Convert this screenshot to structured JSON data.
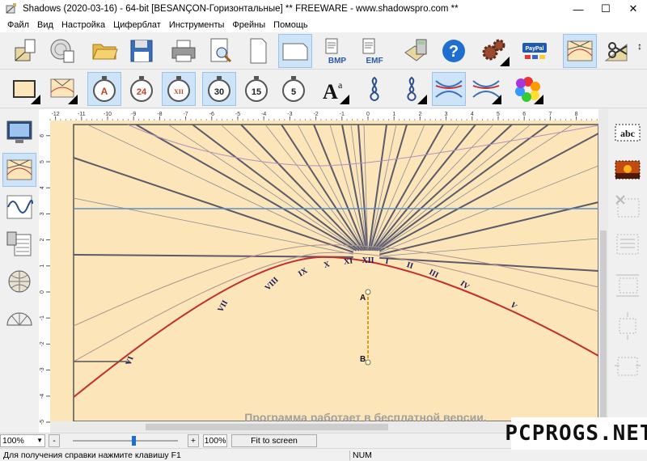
{
  "window": {
    "title": "Shadows (2020-03-16) - 64-bit [BESANÇON-Горизонтальные]   ** FREEWARE - www.shadowspro.com **",
    "minimize": "—",
    "maximize": "☐",
    "close": "✕"
  },
  "menu": [
    "Файл",
    "Вид",
    "Настройка",
    "Циферблат",
    "Инструменты",
    "Фрейны",
    "Помощь"
  ],
  "toolbar1": {
    "bmp_label": "BMP",
    "emf_label": "EMF",
    "help_label": "?",
    "paypal_label": "PayPal"
  },
  "toolbar2": {
    "clock_a": "A",
    "clock_24": "24",
    "clock_xii": "XII",
    "clock_30": "30",
    "clock_15": "15",
    "clock_5": "5",
    "font_label_big": "A",
    "font_label_small": "a"
  },
  "rightbar": {
    "abc_label": "abc"
  },
  "dial": {
    "hour_labels": [
      "VI",
      "VII",
      "VIII",
      "IX",
      "X",
      "XI",
      "XII",
      "I",
      "II",
      "III",
      "IV",
      "V"
    ],
    "point_a": "A",
    "point_b": "B",
    "free_notice": "Программа работает в бесплатной версии.",
    "ruler_x": [
      "-12",
      "-11",
      "-10",
      "-9",
      "-8",
      "-7",
      "-6",
      "-5",
      "-4",
      "-3",
      "-2",
      "-1",
      "0",
      "1",
      "2",
      "3",
      "4",
      "5",
      "6",
      "7",
      "8"
    ],
    "ruler_y": [
      "6",
      "5",
      "4",
      "3",
      "2",
      "1",
      "0",
      "-1",
      "-2",
      "-3",
      "-4",
      "-5"
    ]
  },
  "statusbar": {
    "zoom_value": "100%",
    "zoom_minus": "-",
    "zoom_plus": "+",
    "zoom_pct": "100%",
    "fit_to_screen": "Fit to screen",
    "help_text": "Для получения справки нажмите клавишу F1",
    "num_indicator": "NUM"
  },
  "watermark": "PCPROGS.NET",
  "colors": {
    "dial_background": "#fce6b9",
    "hour_line": "#5a5a6a",
    "horizon_line": "#5a8fc8",
    "equinox_curve": "#c03030",
    "hour_label": "#1a1a5a",
    "gnomon": "#d4a020",
    "selected_button": "#cde3f7"
  }
}
